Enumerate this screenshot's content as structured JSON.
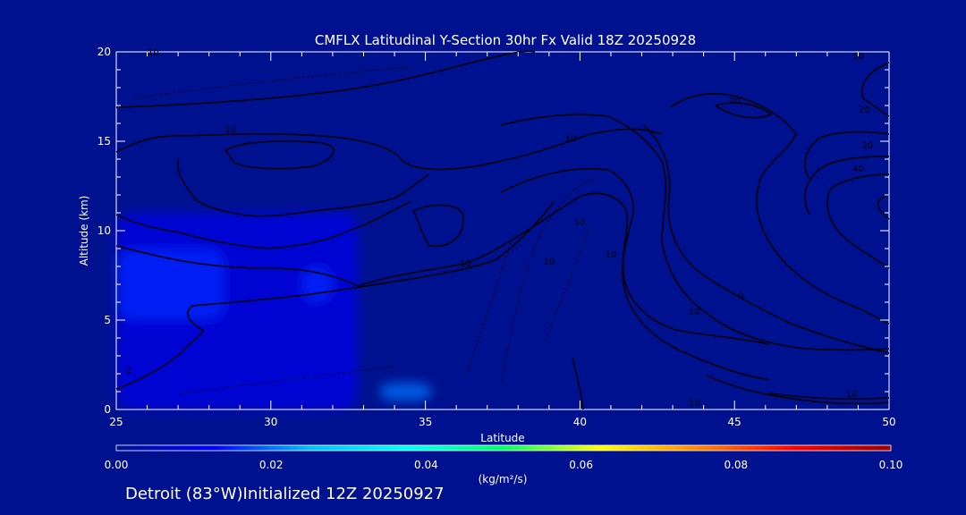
{
  "chart_data": {
    "type": "contour",
    "title": "CMFLX Latitudinal Y-Section 30hr  Fx Valid 18Z 20250928",
    "xlabel": "Latitude",
    "ylabel": "Altitude (km)",
    "xlim": [
      25,
      50
    ],
    "ylim": [
      0,
      20
    ],
    "x_ticks": [
      25,
      30,
      35,
      40,
      45,
      50
    ],
    "y_ticks": [
      0,
      5,
      10,
      15,
      20
    ],
    "grid": false,
    "colorbar": {
      "label": "(kg/m²/s)",
      "min": 0.0,
      "max": 0.1,
      "ticks": [
        "0.00",
        "0.02",
        "0.04",
        "0.06",
        "0.08",
        "0.10"
      ],
      "colors": [
        "#00118f",
        "#0000ff",
        "#00bfff",
        "#00ffff",
        "#00ff66",
        "#ffff00",
        "#ff8800",
        "#ff0000",
        "#990000"
      ]
    },
    "filled_regions": [
      {
        "value": 0.01,
        "lat_range": [
          25,
          32.8
        ],
        "alt_range": [
          0,
          11
        ]
      },
      {
        "value": 0.015,
        "lat_range": [
          25,
          28.5
        ],
        "alt_range": [
          5,
          9
        ]
      },
      {
        "value": 0.015,
        "lat_range": [
          31,
          32
        ],
        "alt_range": [
          6,
          8
        ]
      },
      {
        "value": 0.02,
        "lat_range": [
          33.5,
          35.2
        ],
        "alt_range": [
          0.5,
          1.5
        ]
      }
    ],
    "contour_labels": [
      {
        "text": "10",
        "lat": 26.2,
        "alt": 19.8
      },
      {
        "text": "10",
        "lat": 28.7,
        "alt": 15.5
      },
      {
        "text": "10",
        "lat": 39.7,
        "alt": 15.0
      },
      {
        "text": "10",
        "lat": 40.0,
        "alt": 10.3
      },
      {
        "text": "10",
        "lat": 41.0,
        "alt": 8.5
      },
      {
        "text": "10",
        "lat": 43.7,
        "alt": 5.3
      },
      {
        "text": "10",
        "lat": 43.7,
        "alt": 0.2
      },
      {
        "text": "10",
        "lat": 48.8,
        "alt": 0.7
      },
      {
        "text": "10",
        "lat": 49.0,
        "alt": 19.6
      },
      {
        "text": "10",
        "lat": 36.3,
        "alt": 8.0
      },
      {
        "text": "10",
        "lat": 39.0,
        "alt": 8.1
      },
      {
        "text": "20",
        "lat": 45.0,
        "alt": 17.1
      },
      {
        "text": "20",
        "lat": 49.2,
        "alt": 16.6
      },
      {
        "text": "20",
        "lat": 49.3,
        "alt": 14.6
      },
      {
        "text": "40",
        "lat": 49.0,
        "alt": 13.3
      },
      {
        "text": "0",
        "lat": 45.2,
        "alt": 6.2
      },
      {
        "text": "0",
        "lat": 25.4,
        "alt": 2.0
      }
    ]
  },
  "footer": {
    "text": "Detroit (83°W)Initialized 12Z 20250927"
  }
}
